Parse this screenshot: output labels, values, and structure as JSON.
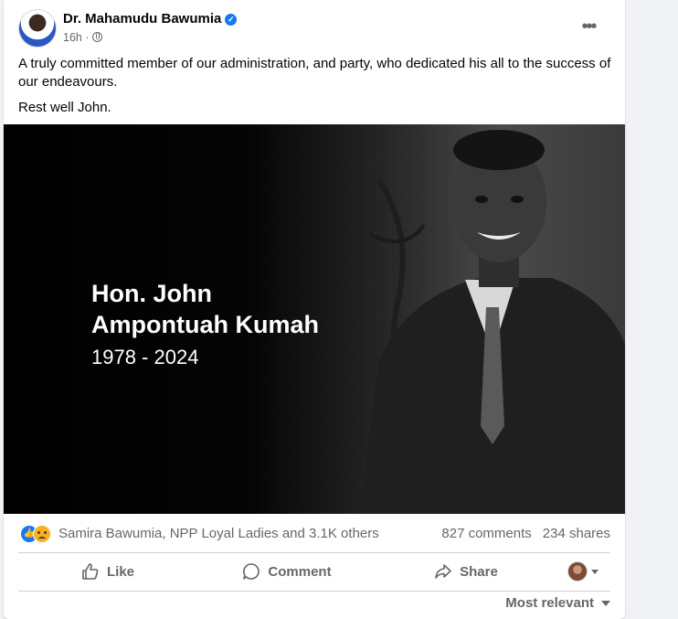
{
  "post": {
    "author": "Dr. Mahamudu Bawumia",
    "timestamp": "16h",
    "body": [
      "A truly committed member of our administration, and party, who dedicated his all to the success of our endeavours.",
      "Rest well John."
    ],
    "image": {
      "name_line1": "Hon. John",
      "name_line2": "Ampontuah Kumah",
      "years": "1978 - 2024"
    }
  },
  "reactions": {
    "icons": [
      "like-icon",
      "sad-icon"
    ],
    "summary": "Samira Bawumia, NPP Loyal Ladies and 3.1K others",
    "comments": "827 comments",
    "shares": "234 shares"
  },
  "actions": {
    "like": "Like",
    "comment": "Comment",
    "share": "Share"
  },
  "comments_sort": "Most relevant",
  "colors": {
    "accent": "#1877f2",
    "text_secondary": "#65676b"
  }
}
